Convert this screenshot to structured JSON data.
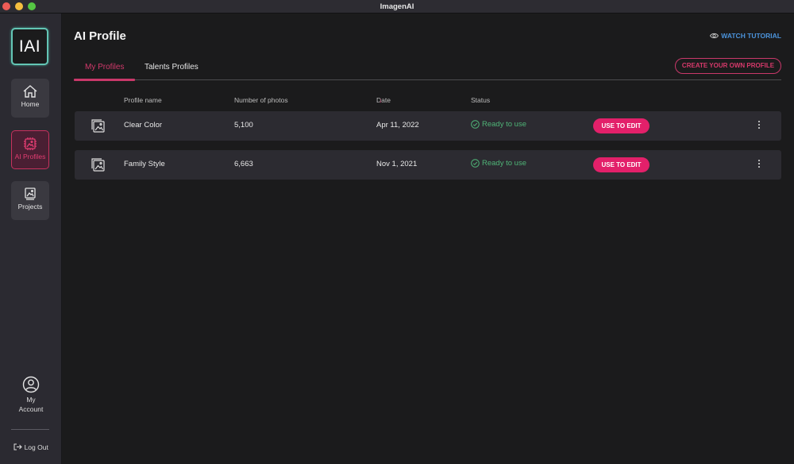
{
  "window": {
    "title": "ImagenAI"
  },
  "sidebar": {
    "logo_text": "IAI",
    "items": [
      {
        "label": "Home",
        "icon": "home-icon",
        "active": false
      },
      {
        "label": "AI Profiles",
        "icon": "ai-chip-icon",
        "active": true
      },
      {
        "label": "Projects",
        "icon": "projects-icon",
        "active": false
      }
    ],
    "account_line1": "My",
    "account_line2": "Account",
    "logout_label": "Log Out"
  },
  "header": {
    "title": "AI Profile",
    "watch_tutorial": "WATCH TUTORIAL",
    "create_profile": "CREATE YOUR OWN PROFILE"
  },
  "tabs": [
    {
      "label": "My Profiles",
      "active": true
    },
    {
      "label": "Talents Profiles",
      "active": false
    }
  ],
  "table": {
    "columns": [
      "Profile name",
      "Number of photos",
      "Date",
      "Status"
    ],
    "sort_indicator": "↓",
    "rows": [
      {
        "name": "Clear Color",
        "photos": "5,100",
        "date": "Apr 11, 2022",
        "status": "Ready to use",
        "action": "USE TO EDIT"
      },
      {
        "name": "Family Style",
        "photos": "6,663",
        "date": "Nov 1, 2021",
        "status": "Ready to use",
        "action": "USE TO EDIT"
      }
    ]
  },
  "colors": {
    "accent": "#e3206a",
    "accent_outline": "#c9386a",
    "logo_border": "#63c6b5",
    "status_ok": "#4fb477",
    "link": "#4b93db"
  }
}
